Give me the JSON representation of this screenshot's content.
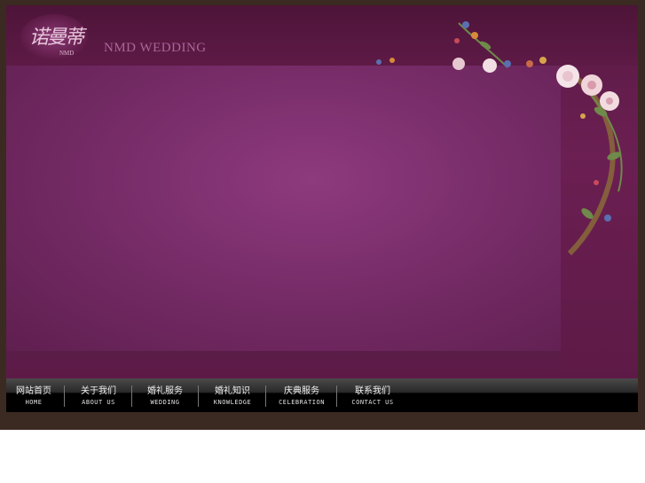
{
  "header": {
    "logo_cn": "诺曼蒂",
    "logo_sub": "NMD",
    "brand": "NMD WEDDING"
  },
  "nav": {
    "items": [
      {
        "cn": "网站首页",
        "en": "HOME"
      },
      {
        "cn": "关于我们",
        "en": "ABOUT US"
      },
      {
        "cn": "婚礼服务",
        "en": "WEDDING"
      },
      {
        "cn": "婚礼知识",
        "en": "KNOWLEDGE"
      },
      {
        "cn": "庆典服务",
        "en": "CELEBRATION"
      },
      {
        "cn": "联系我们",
        "en": "CONTACT US"
      }
    ]
  },
  "colors": {
    "background": "#5e1a47",
    "panel": "#7a2e6b",
    "nav": "#000000"
  }
}
